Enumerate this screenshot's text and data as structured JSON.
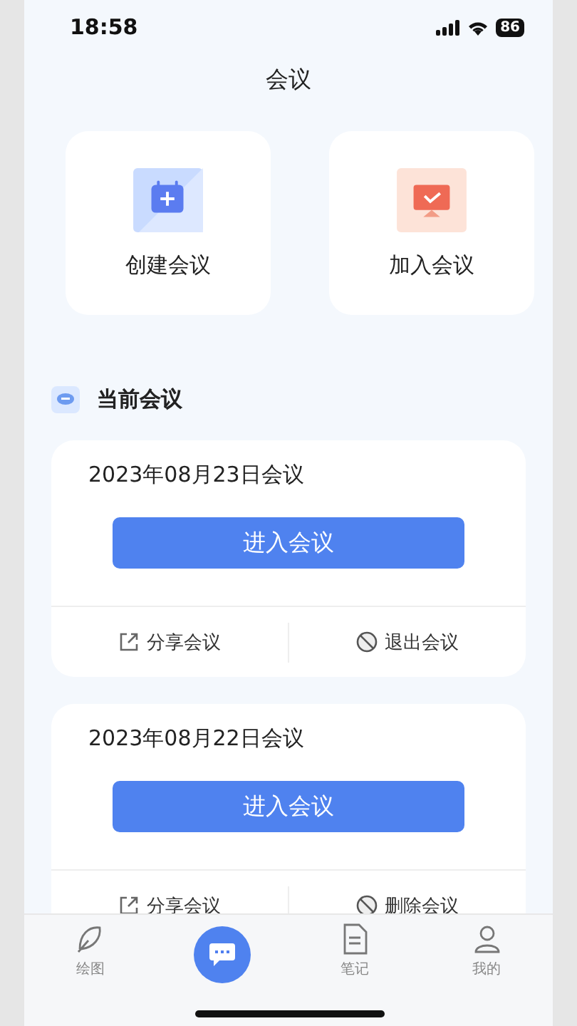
{
  "status_bar": {
    "time": "18:58",
    "battery": "86"
  },
  "header": {
    "title": "会议"
  },
  "actions": [
    {
      "kind": "create",
      "label": "创建会议"
    },
    {
      "kind": "join",
      "label": "加入会议"
    }
  ],
  "section": {
    "title": "当前会议"
  },
  "meetings": [
    {
      "title": "2023年08月23日会议",
      "enter": "进入会议",
      "share": "分享会议",
      "second_action": "退出会议"
    },
    {
      "title": "2023年08月22日会议",
      "enter": "进入会议",
      "share": "分享会议",
      "second_action": "删除会议"
    }
  ],
  "tab_bar": [
    {
      "kind": "draw",
      "label": "绘图",
      "selected": false
    },
    {
      "kind": "meeting",
      "selected": true
    },
    {
      "kind": "notes",
      "label": "笔记",
      "selected": false
    },
    {
      "kind": "me",
      "label": "我的",
      "selected": false
    }
  ]
}
